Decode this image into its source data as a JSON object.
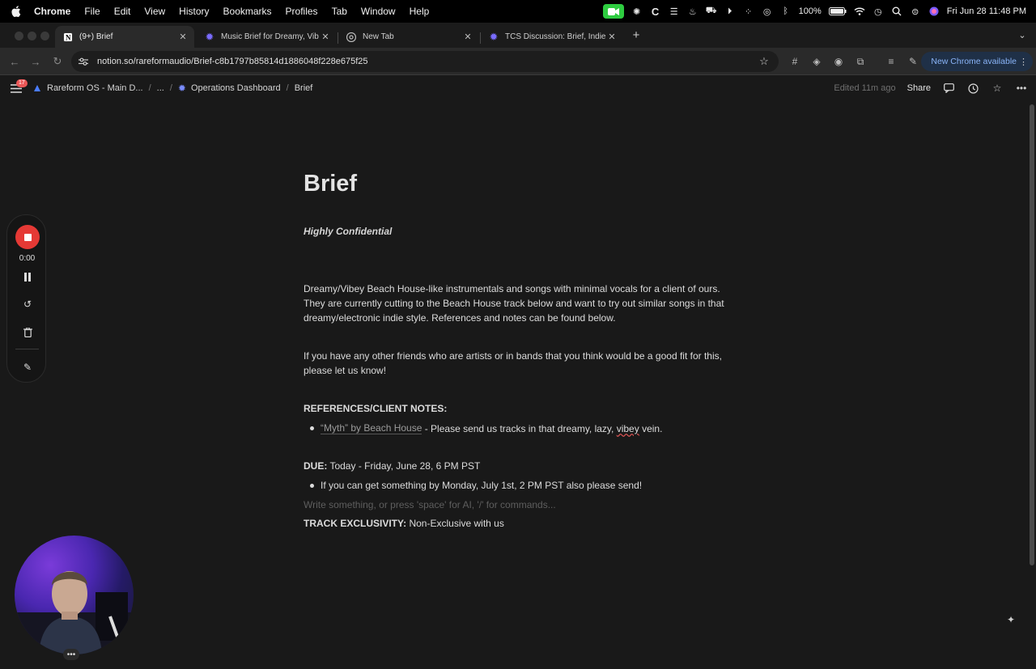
{
  "menubar": {
    "items": [
      "Chrome",
      "File",
      "Edit",
      "View",
      "History",
      "Bookmarks",
      "Profiles",
      "Tab",
      "Window",
      "Help"
    ],
    "battery": "100%",
    "datetime": "Fri Jun 28  11:48 PM"
  },
  "tabs": [
    {
      "title": "(9+) Brief",
      "icon": "notion-icon"
    },
    {
      "title": "Music Brief for Dreamy, Vibey",
      "icon": "gear-icon"
    },
    {
      "title": "New Tab",
      "icon": "chrome-icon"
    },
    {
      "title": "TCS Discussion: Brief, Indie, I",
      "icon": "gear-icon"
    }
  ],
  "toolbar": {
    "url": "notion.so/rareformaudio/Brief-c8b1797b85814d1886048f228e675f25",
    "new_chrome": "New Chrome available"
  },
  "notion": {
    "notification_count": "17",
    "breadcrumbs": [
      "Rareform OS - Main D...",
      "...",
      "Operations Dashboard",
      "Brief"
    ],
    "edited": "Edited 11m ago",
    "share": "Share"
  },
  "doc": {
    "title": "Brief",
    "subtitle": "Highly Confidential",
    "para1": "Dreamy/Vibey Beach House-like instrumentals and songs with minimal vocals for a client of ours. They are currently cutting to the Beach House track below and want to try out similar songs in that dreamy/electronic indie style. References and notes can be found below.",
    "para2": "If you have any other friends who are artists or in bands that you think would be a good fit for this, please let us know!",
    "refs_heading": "REFERENCES/CLIENT NOTES:",
    "ref_link": "“Myth” by Beach House",
    "ref_text_before": " - Please send us tracks in that dreamy, lazy, ",
    "ref_squiggle": "vibey",
    "ref_text_after": " vein.",
    "due_label": "DUE:",
    "due_value": " Today - Friday, June 28, 6 PM PST",
    "due_bullet": "If you can get something by Monday, July 1st, 2 PM PST also please send!",
    "placeholder": "Write something, or press 'space' for AI, '/' for commands...",
    "exclusivity_label": "TRACK EXCLUSIVITY:",
    "exclusivity_value": " Non-Exclusive with us"
  },
  "recorder": {
    "time": "0:00"
  }
}
